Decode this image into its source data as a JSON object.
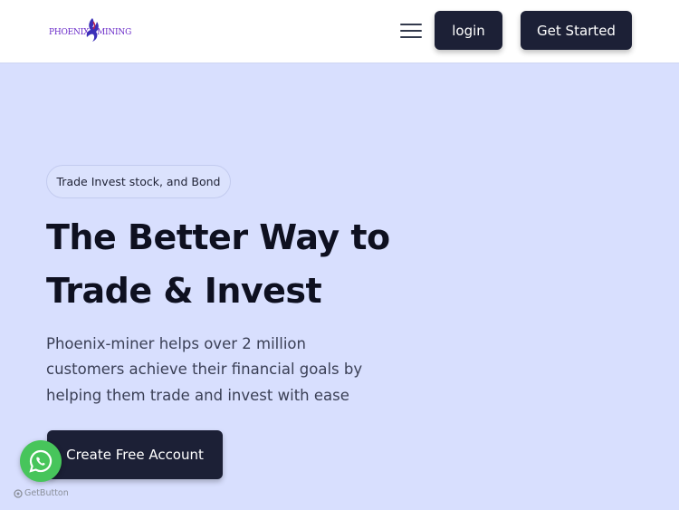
{
  "header": {
    "logo": {
      "left_text": "PHOENIX",
      "right_text": "MINING"
    },
    "menu_icon": "hamburger-icon",
    "login_label": "login",
    "get_started_label": "Get Started"
  },
  "hero": {
    "pill_text": "Trade Invest stock, and Bond",
    "headline_line1": "The Better Way to",
    "headline_line2": "Trade & Invest",
    "subtitle_line1": "Phoenix-miner helps over 2 million",
    "subtitle_line2": "customers achieve their financial goals by",
    "subtitle_line3": "helping them trade and invest with ease",
    "cta_label": "Create Free Account"
  },
  "widget": {
    "icon": "whatsapp-icon",
    "brand_label": "GetButton"
  },
  "colors": {
    "hero_background": "#d8dffe",
    "button_dark": "#1c2036",
    "whatsapp_green": "#47c55b",
    "logo_purple": "#6a2bc9"
  }
}
